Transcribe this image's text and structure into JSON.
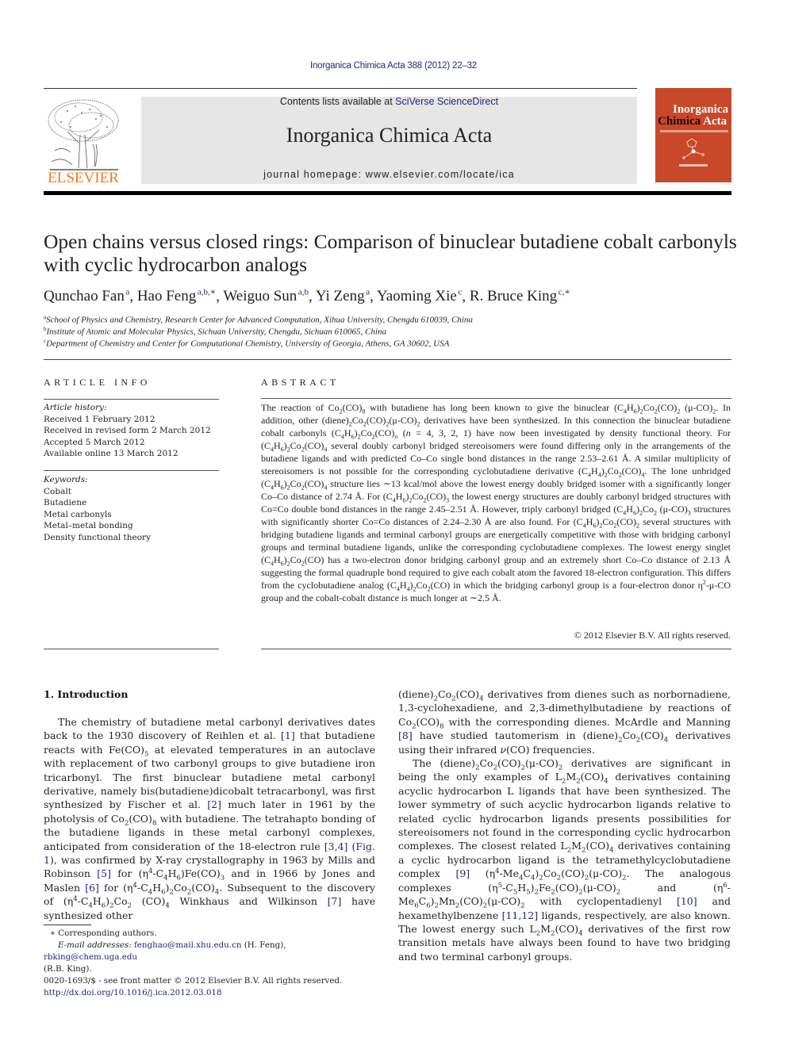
{
  "running_head": "Inorganica Chimica Acta 388 (2012) 22–32",
  "masthead": {
    "contents_prefix": "Contents lists available at ",
    "contents_link": "SciVerse ScienceDirect",
    "journal_title": "Inorganica Chimica Acta",
    "homepage": "journal homepage: www.elsevier.com/locate/ica",
    "publisher_logo_text": "ELSEVIER",
    "cover": {
      "title_line1": "Inorganica",
      "title_line2_dark": "Chimica",
      "title_line2_light": "Acta",
      "color": "#c8482a"
    }
  },
  "article": {
    "title": "Open chains versus closed rings: Comparison of binuclear butadiene cobalt carbonyls with cyclic hydrocarbon analogs",
    "authors": [
      {
        "name": "Qunchao Fan",
        "affil": "a"
      },
      {
        "name": "Hao Feng",
        "affil": "a,b,∗"
      },
      {
        "name": "Weiguo Sun",
        "affil": "a,b"
      },
      {
        "name": "Yi Zeng",
        "affil": "a"
      },
      {
        "name": "Yaoming Xie",
        "affil": "c"
      },
      {
        "name": "R. Bruce King",
        "affil": "c,∗"
      }
    ],
    "affiliations": [
      {
        "key": "a",
        "text": "School of Physics and Chemistry, Research Center for Advanced Computation, Xihua University, Chengdu 610039, China"
      },
      {
        "key": "b",
        "text": "Institute of Atomic and Molecular Physics, Sichuan University, Chengdu, Sichuan 610065, China"
      },
      {
        "key": "c",
        "text": "Department of Chemistry and Center for Computational Chemistry, University of Georgia, Athens, GA 30602, USA"
      }
    ]
  },
  "article_info": {
    "heading": "ARTICLE INFO",
    "history_label": "Article history:",
    "history": [
      "Received 1 February 2012",
      "Received in revised form 2 March 2012",
      "Accepted 5 March 2012",
      "Available online 13 March 2012"
    ],
    "keywords_label": "Keywords:",
    "keywords": [
      "Cobalt",
      "Butadiene",
      "Metal carbonyls",
      "Metal–metal bonding",
      "Density functional theory"
    ]
  },
  "abstract": {
    "heading": "ABSTRACT",
    "copyright": "© 2012 Elsevier B.V. All rights reserved."
  },
  "introduction": {
    "heading": "1. Introduction",
    "refs": [
      "[1]",
      "[2]",
      "[3,4]",
      "Fig. 1",
      "[5]",
      "[6]",
      "[7]",
      "[8]",
      "[9]",
      "[10]",
      "[11,12]"
    ]
  },
  "footnotes": {
    "corresponding": "∗ Corresponding authors.",
    "email_label": "E-mail addresses:",
    "email1": "fenghao@mail.xhu.edu.cn",
    "email1_who": " (H. Feng), ",
    "email2": "rbking@chem.uga.edu",
    "email2_who": "(R.B. King).",
    "front_matter": "0020-1693/$ - see front matter © 2012 Elsevier B.V. All rights reserved.",
    "doi": "http://dx.doi.org/10.1016/j.ica.2012.03.018"
  },
  "colors": {
    "link": "#1f2a7a",
    "elsevier_orange": "#f07d1a",
    "banner_gray": "#e6e6e6"
  }
}
